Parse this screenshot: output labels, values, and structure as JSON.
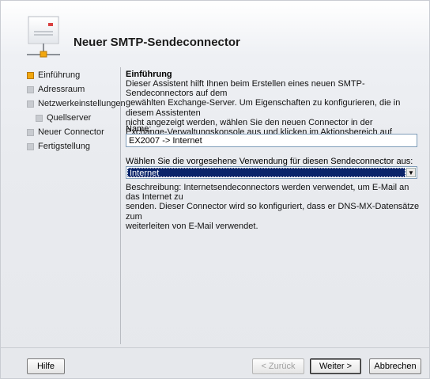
{
  "window": {
    "title": "Neuer SMTP-Sendeconnector"
  },
  "nav": {
    "items": [
      {
        "label": "Einführung",
        "active": true
      },
      {
        "label": "Adressraum",
        "active": false
      },
      {
        "label": "Netzwerkeinstellungen",
        "active": false
      },
      {
        "label": "Quellserver",
        "active": false
      },
      {
        "label": "Neuer Connector",
        "active": false
      },
      {
        "label": "Fertigstellung",
        "active": false
      }
    ]
  },
  "content": {
    "section_title": "Einführung",
    "intro_lines": [
      "Dieser Assistent hilft Ihnen beim Erstellen eines neuen SMTP-Sendeconnectors auf dem",
      "gewählten Exchange-Server. Um Eigenschaften zu konfigurieren, die in diesem Assistenten",
      "nicht angezeigt werden, wählen Sie den neuen Connector in der",
      "Exchange-Verwaltungskonsole aus und klicken im Aktionsbereich auf 'Eigenschaften'."
    ],
    "name_label": "Name:",
    "name_value": "EX2007 -> Internet",
    "usage_label": "Wählen Sie die vorgesehene Verwendung für diesen Sendeconnector aus:",
    "usage_value": "Internet",
    "description_lines": [
      "Beschreibung: Internetsendeconnectors werden verwendet, um E-Mail an das Internet zu",
      "senden. Dieser Connector wird so konfiguriert, dass er DNS-MX-Datensätze zum",
      "weiterleiten von E-Mail verwendet."
    ]
  },
  "buttons": {
    "help": "Hilfe",
    "back": "< Zurück",
    "next": "Weiter >",
    "cancel": "Abbrechen"
  },
  "colors": {
    "active_step": "#f2a70f",
    "inactive_step": "#c8cbd0",
    "selection": "#0a246a"
  }
}
